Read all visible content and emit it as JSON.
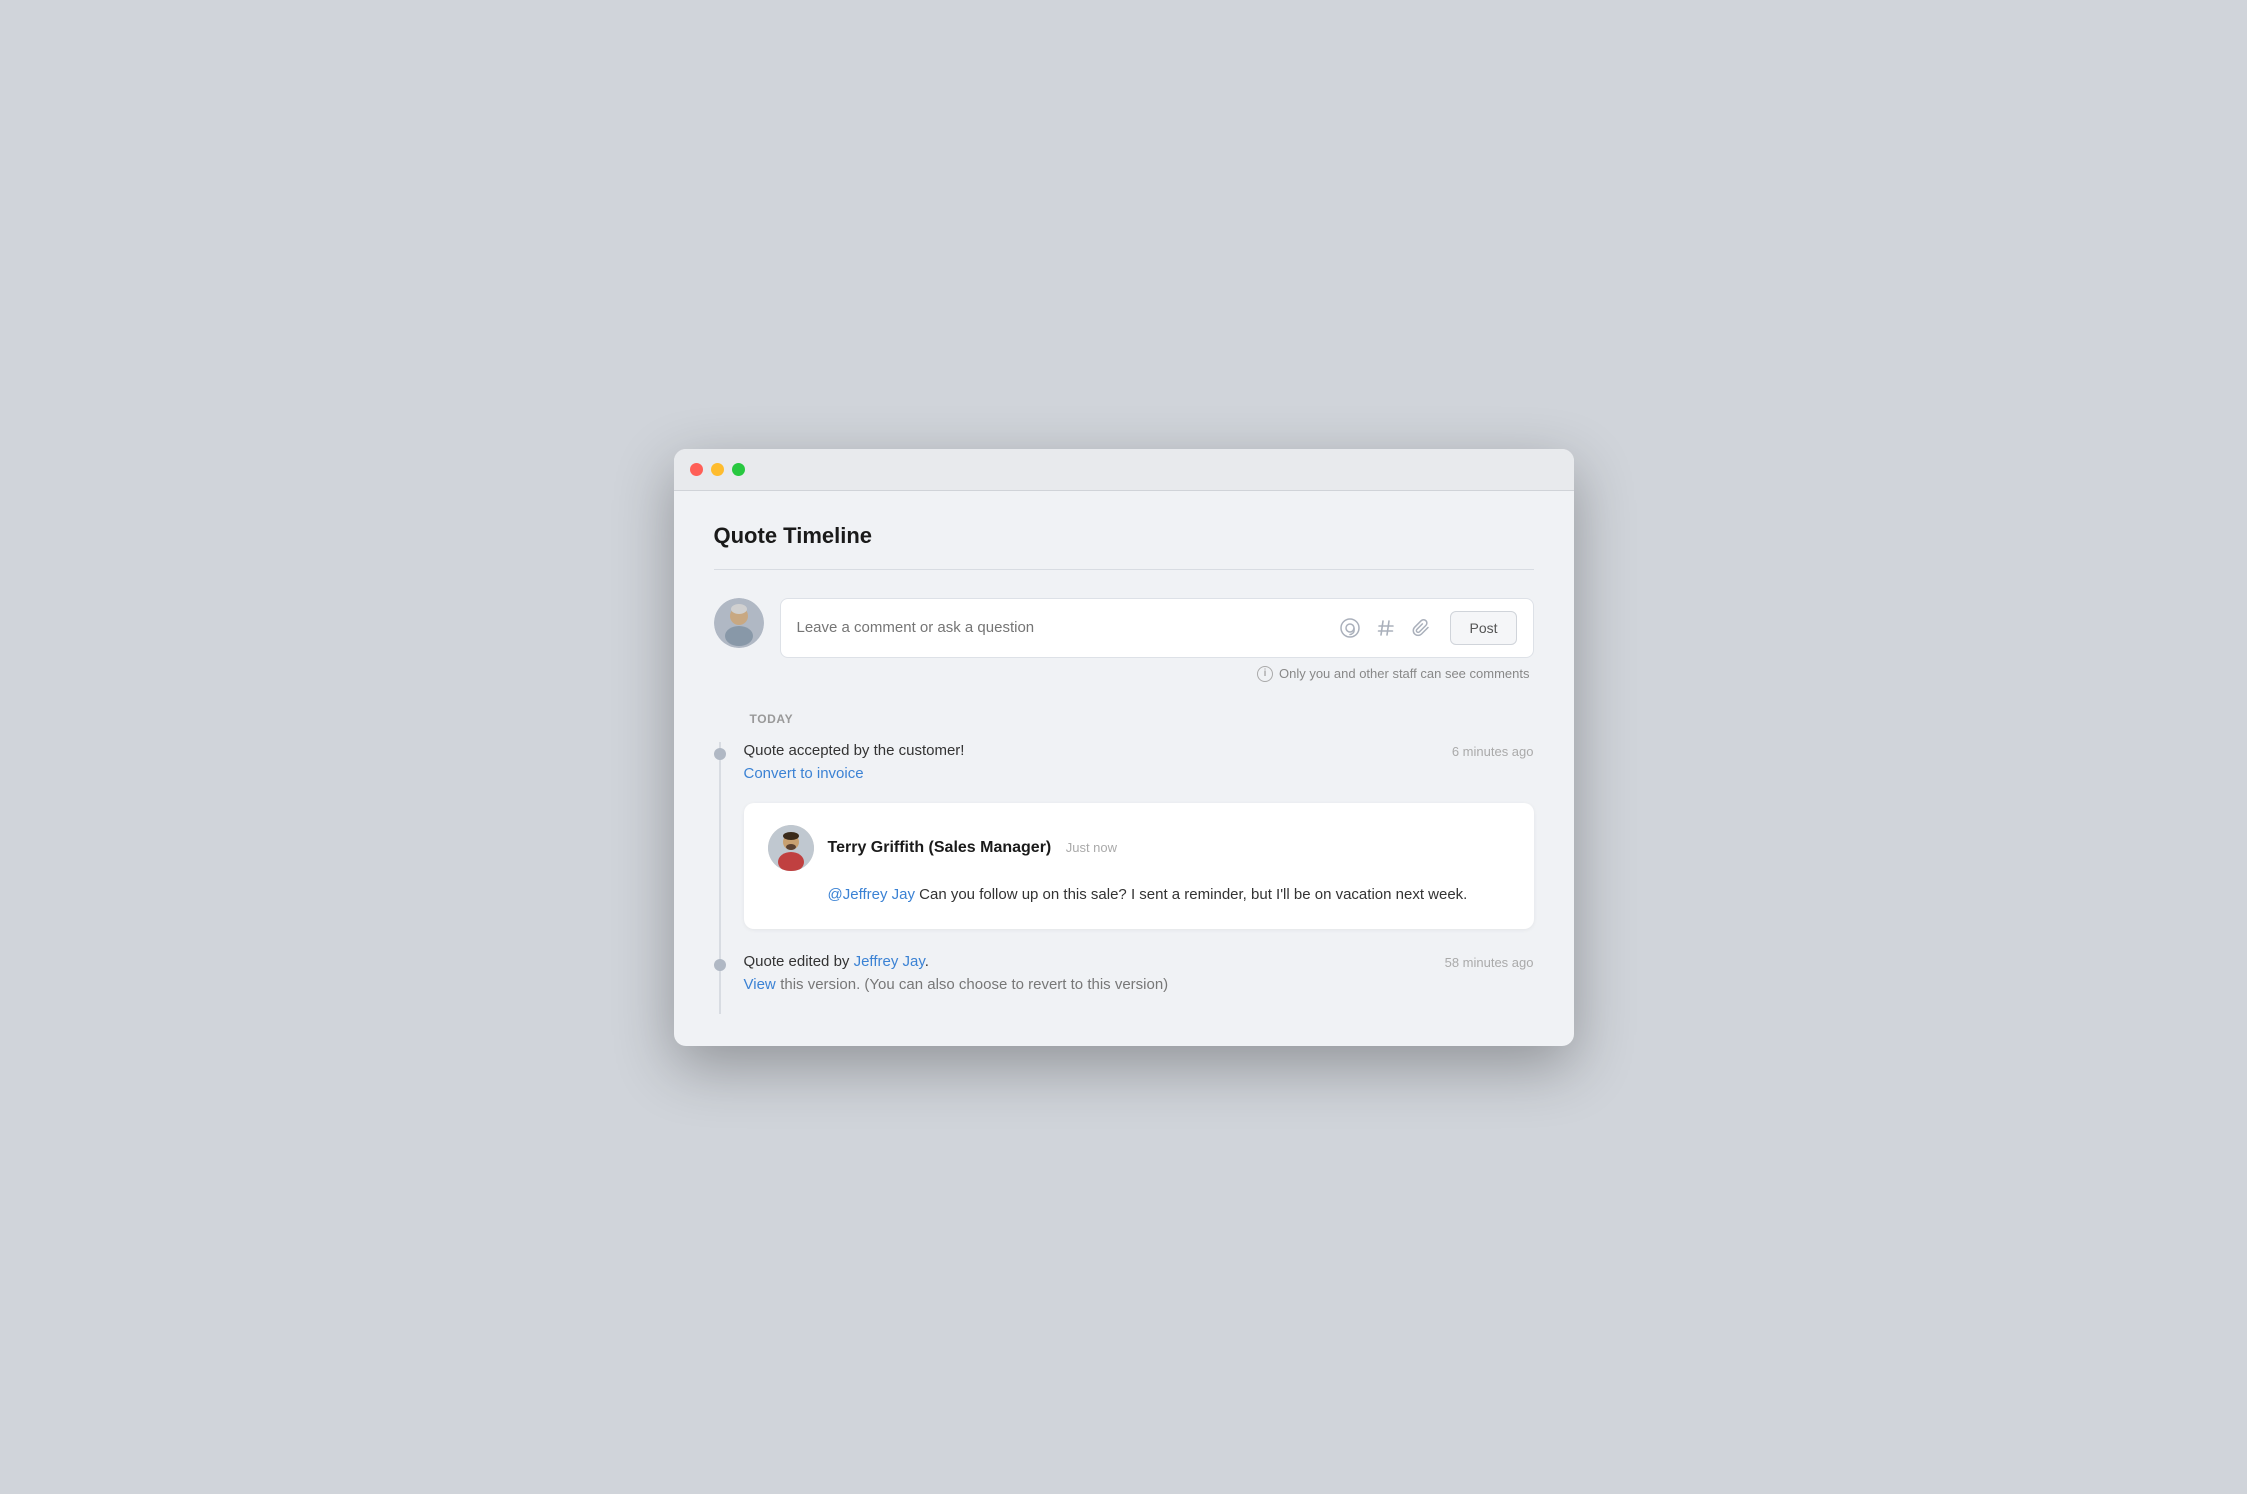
{
  "window": {
    "title": "Quote Timeline"
  },
  "page": {
    "title": "Quote Timeline"
  },
  "comment_input": {
    "placeholder": "Leave a comment or ask a question"
  },
  "icons": {
    "at": "@",
    "hash": "#",
    "paperclip": "📎"
  },
  "post_button": {
    "label": "Post"
  },
  "staff_note": {
    "text": "Only you and other staff can see comments"
  },
  "timeline": {
    "today_label": "TODAY",
    "events": [
      {
        "id": "quote-accepted",
        "text": "Quote accepted by the customer!",
        "time": "6 minutes ago",
        "action_label": "Convert to invoice"
      },
      {
        "id": "quote-edited",
        "text_prefix": "Quote edited by ",
        "author": "Jeffrey Jay",
        "text_suffix": ".",
        "time": "58 minutes ago",
        "view_label": "View",
        "view_note": "this version. (You can also choose to revert to this version)"
      }
    ]
  },
  "comment": {
    "author_name": "Terry Griffith (Sales Manager)",
    "author_time": "Just now",
    "mention": "@Jeffrey Jay",
    "text": " Can you follow up on this sale? I sent a reminder, but I'll be on vacation next week."
  }
}
